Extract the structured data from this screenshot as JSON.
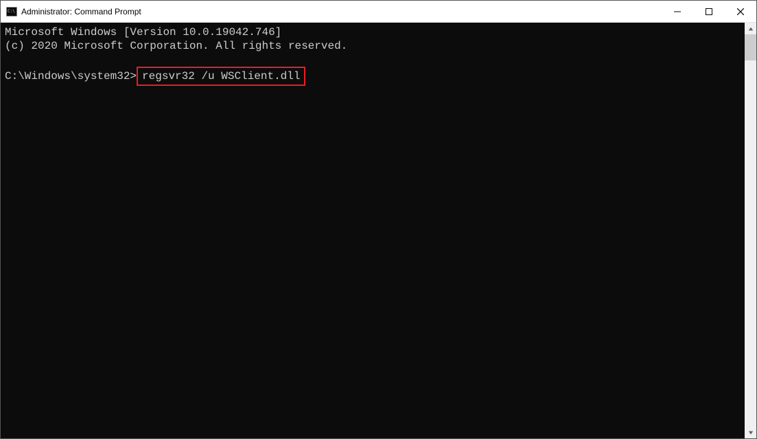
{
  "window": {
    "title": "Administrator: Command Prompt"
  },
  "console": {
    "line1": "Microsoft Windows [Version 10.0.19042.746]",
    "line2": "(c) 2020 Microsoft Corporation. All rights reserved.",
    "blank": "",
    "prompt": "C:\\Windows\\system32>",
    "command": "regsvr32 /u WSClient.dll"
  }
}
